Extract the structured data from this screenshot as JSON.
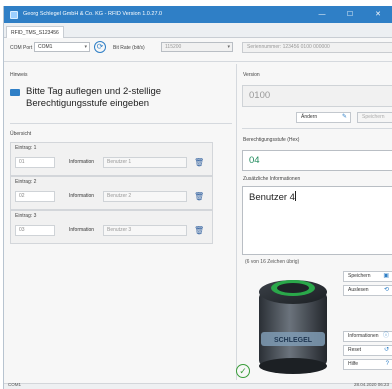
{
  "window": {
    "title": "Georg Schlegel GmbH & Co. KG - RFID Version 1.0.27.0",
    "minimize_glyph": "—",
    "maximize_glyph": "☐",
    "close_glyph": "✕",
    "icons": [
      "app-icon",
      "keyboard-icon",
      "refresh-icon",
      "pencil-icon",
      "save-icon",
      "trash-icon",
      "check-icon"
    ]
  },
  "tab": {
    "label": "RFID_TMS_S123456"
  },
  "toolbar": {
    "com_port_label": "COM Port",
    "com_port_value": "COM1",
    "bitrate_label": "Bit Rate (bit/s)",
    "bitrate_value": "115200",
    "serial_text": "Seriennummer: 123456 0100 000000"
  },
  "hint": {
    "title": "Hinweis",
    "text": "Bitte Tag auflegen und 2-stellige Berechtigungsstufe eingeben"
  },
  "overview": {
    "title": "Übersicht",
    "entries": [
      {
        "label": "Eintrag: 1",
        "number": "01",
        "info_label": "Information",
        "user": "Benutzer 1"
      },
      {
        "label": "Eintrag: 2",
        "number": "02",
        "info_label": "Information",
        "user": "Benutzer 2"
      },
      {
        "label": "Eintrag: 3",
        "number": "03",
        "info_label": "Information",
        "user": "Benutzer 3"
      }
    ]
  },
  "version": {
    "title": "Version",
    "value": "0100",
    "change_label": "Ändern",
    "save_label": "Speichern"
  },
  "level": {
    "title": "Berechtigungsstufe (Hex)",
    "value": "04"
  },
  "info": {
    "title": "Zusätzliche Informationen",
    "value": "Benutzer 4",
    "chars_left": "(6 von 16 Zeichen übrig)"
  },
  "actions": {
    "save": "Speichern",
    "read": "Auslesen",
    "information": "Informationen",
    "reset": "Reset",
    "help": "Hilfe"
  },
  "device": {
    "brand": "SCHLEGEL"
  },
  "statusbar": {
    "port": "COM1",
    "datetime": "28.04.2020 06:23"
  },
  "colors": {
    "titlebar": "#2f7fc6",
    "accent": "#2f7fc6",
    "level_text": "#1f8a5c",
    "device_green": "#2aa84a",
    "status_ok": "#3a9d3a"
  }
}
